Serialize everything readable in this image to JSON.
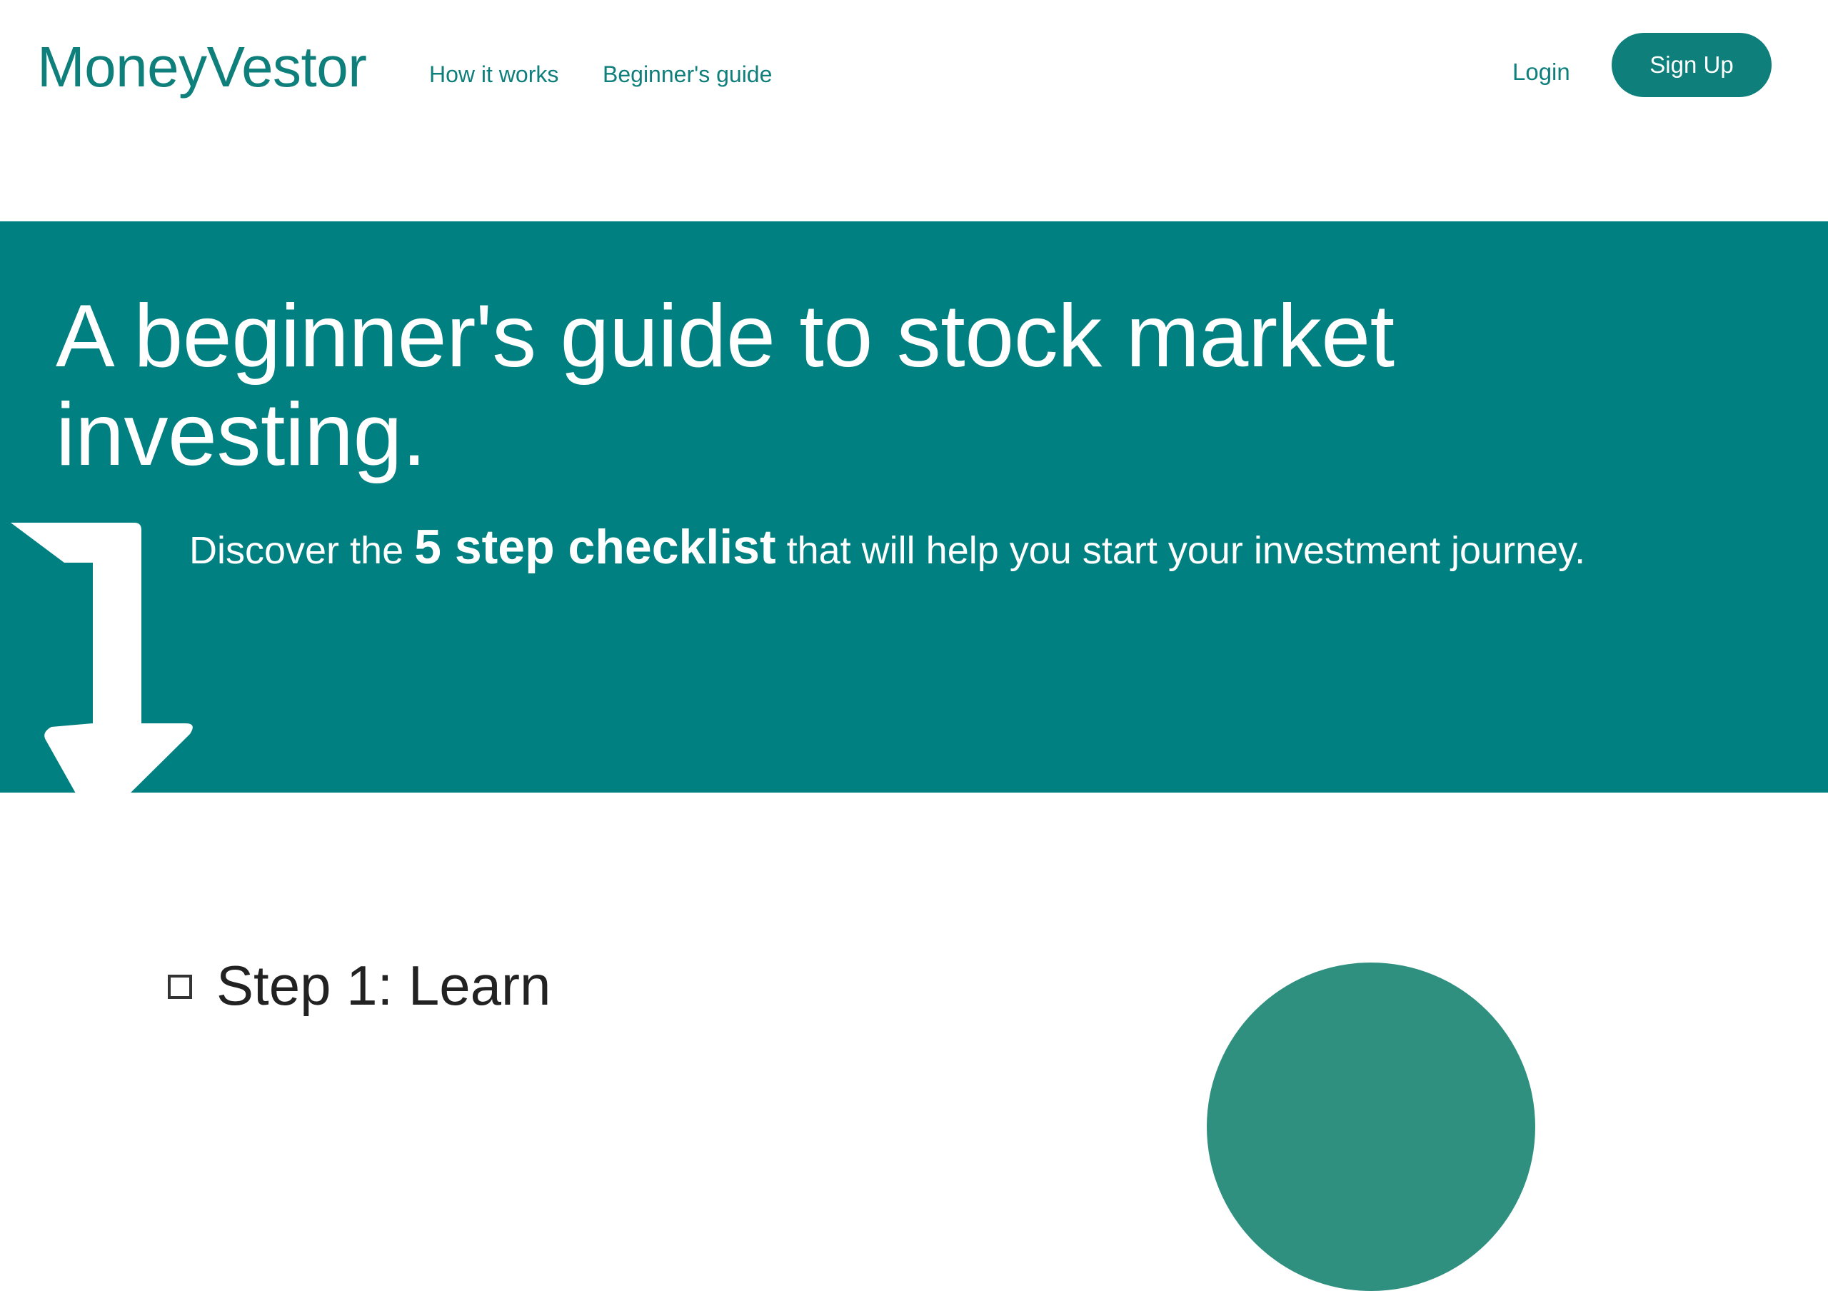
{
  "header": {
    "brand": "MoneyVestor",
    "nav": {
      "how_it_works": "How it works",
      "beginners_guide": "Beginner's guide"
    },
    "login_label": "Login",
    "signup_label": "Sign Up"
  },
  "hero": {
    "title": "A beginner's guide to stock market investing.",
    "subtitle_prefix": "Discover the ",
    "subtitle_emphasis": "5 step checklist",
    "subtitle_suffix": " that will help you start your investment journey.",
    "arrow_icon": "arrow-turn-down-icon"
  },
  "steps": [
    {
      "label": "Step 1: Learn",
      "checked": false
    }
  ],
  "colors": {
    "brand": "#0f7f7c",
    "hero_background": "#008080",
    "decorative_circle": "#2f9080",
    "text_dark": "#222222",
    "white": "#ffffff"
  }
}
